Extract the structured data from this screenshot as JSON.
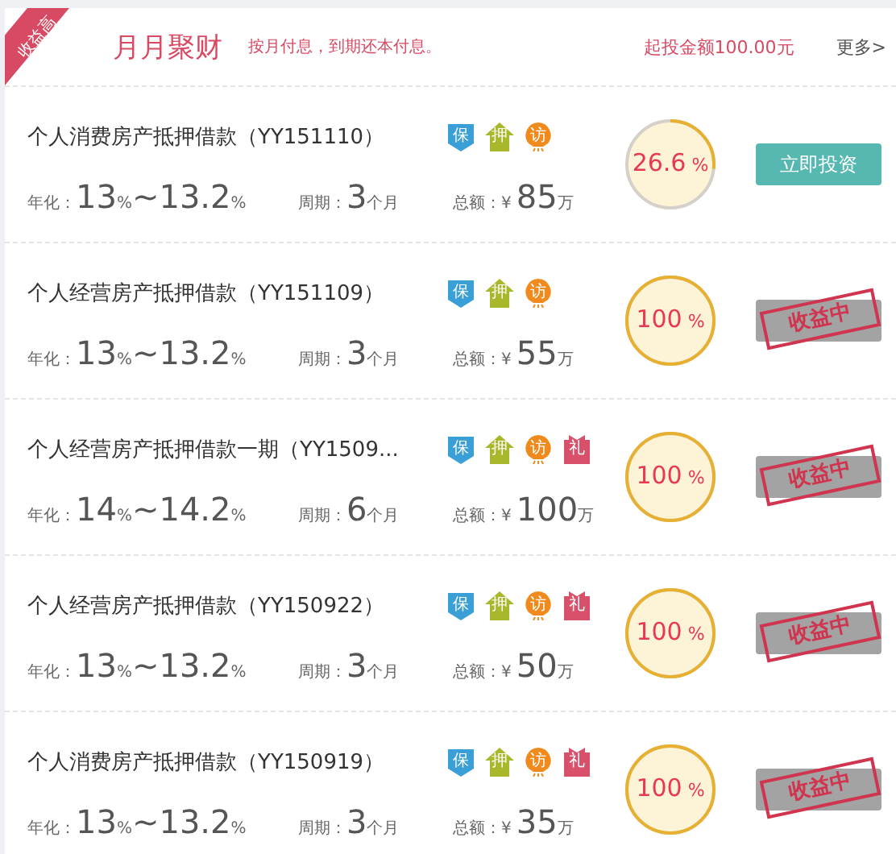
{
  "header": {
    "ribbon": "收益高",
    "title": "月月聚财",
    "subtitle": "按月付息，到期还本付息。",
    "min_invest": "起投金额100.00元",
    "more": "更多>"
  },
  "products": [
    {
      "name": "个人消费房产抵押借款（YY151110）",
      "tags": [
        {
          "kind": "shield",
          "text": "保"
        },
        {
          "kind": "house",
          "text": "押"
        },
        {
          "kind": "balloon",
          "text": "访"
        }
      ],
      "rate": {
        "label": "年化：",
        "low": "13",
        "low_unit": "%",
        "sep": "~",
        "high": "13.2",
        "high_unit": "%"
      },
      "term": {
        "label": "周期：",
        "value": "3",
        "unit": "个月"
      },
      "total": {
        "label": "总额：",
        "currency": "¥",
        "value": "85",
        "unit": "万"
      },
      "progress": {
        "value": "26.6",
        "unit": "%"
      },
      "action": {
        "kind": "invest",
        "label": "立即投资"
      }
    },
    {
      "name": "个人经营房产抵押借款（YY151109）",
      "tags": [
        {
          "kind": "shield",
          "text": "保"
        },
        {
          "kind": "house",
          "text": "押"
        },
        {
          "kind": "balloon",
          "text": "访"
        }
      ],
      "rate": {
        "label": "年化：",
        "low": "13",
        "low_unit": "%",
        "sep": "~",
        "high": "13.2",
        "high_unit": "%"
      },
      "term": {
        "label": "周期：",
        "value": "3",
        "unit": "个月"
      },
      "total": {
        "label": "总额：",
        "currency": "¥",
        "value": "55",
        "unit": "万"
      },
      "progress": {
        "value": "100",
        "unit": "%"
      },
      "action": {
        "kind": "earning",
        "stamp": "收益中"
      }
    },
    {
      "name": "个人经营房产抵押借款一期（YY1509...",
      "tags": [
        {
          "kind": "shield",
          "text": "保"
        },
        {
          "kind": "house",
          "text": "押"
        },
        {
          "kind": "balloon",
          "text": "访"
        },
        {
          "kind": "gift",
          "text": "礼"
        }
      ],
      "rate": {
        "label": "年化：",
        "low": "14",
        "low_unit": "%",
        "sep": "~",
        "high": "14.2",
        "high_unit": "%"
      },
      "term": {
        "label": "周期：",
        "value": "6",
        "unit": "个月"
      },
      "total": {
        "label": "总额：",
        "currency": "¥",
        "value": "100",
        "unit": "万"
      },
      "progress": {
        "value": "100",
        "unit": "%"
      },
      "action": {
        "kind": "earning",
        "stamp": "收益中"
      }
    },
    {
      "name": "个人经营房产抵押借款（YY150922）",
      "tags": [
        {
          "kind": "shield",
          "text": "保"
        },
        {
          "kind": "house",
          "text": "押"
        },
        {
          "kind": "balloon",
          "text": "访"
        },
        {
          "kind": "gift",
          "text": "礼"
        }
      ],
      "rate": {
        "label": "年化：",
        "low": "13",
        "low_unit": "%",
        "sep": "~",
        "high": "13.2",
        "high_unit": "%"
      },
      "term": {
        "label": "周期：",
        "value": "3",
        "unit": "个月"
      },
      "total": {
        "label": "总额：",
        "currency": "¥",
        "value": "50",
        "unit": "万"
      },
      "progress": {
        "value": "100",
        "unit": "%"
      },
      "action": {
        "kind": "earning",
        "stamp": "收益中"
      }
    },
    {
      "name": "个人消费房产抵押借款（YY150919）",
      "tags": [
        {
          "kind": "shield",
          "text": "保"
        },
        {
          "kind": "house",
          "text": "押"
        },
        {
          "kind": "balloon",
          "text": "访"
        },
        {
          "kind": "gift",
          "text": "礼"
        }
      ],
      "rate": {
        "label": "年化：",
        "low": "13",
        "low_unit": "%",
        "sep": "~",
        "high": "13.2",
        "high_unit": "%"
      },
      "term": {
        "label": "周期：",
        "value": "3",
        "unit": "个月"
      },
      "total": {
        "label": "总额：",
        "currency": "¥",
        "value": "35",
        "unit": "万"
      },
      "progress": {
        "value": "100",
        "unit": "%"
      },
      "action": {
        "kind": "earning",
        "stamp": "收益中"
      }
    }
  ]
}
